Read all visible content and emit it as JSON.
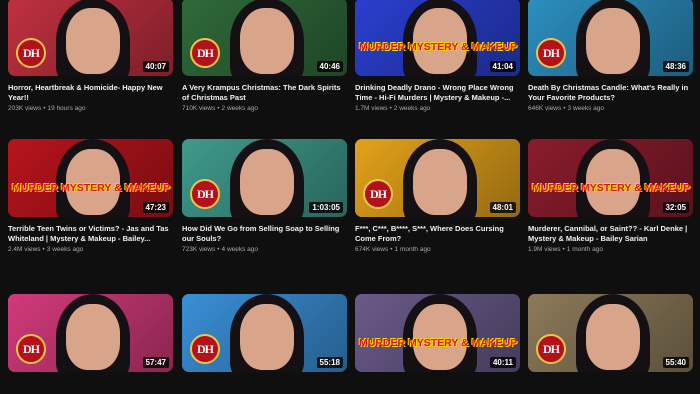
{
  "videos": [
    {
      "title": "Horror, Heartbreak & Homicide- Happy New Year!!",
      "views": "203K views",
      "age": "19 hours ago",
      "duration": "40:07",
      "bg": "#c03040",
      "badge": ""
    },
    {
      "title": "A Very Krampus Christmas: The Dark Spirits of Christmas Past",
      "views": "710K views",
      "age": "2 weeks ago",
      "duration": "40:46",
      "bg": "#2f6a3a",
      "badge": ""
    },
    {
      "title": "Drinking Deadly Drano - Wrong Place Wrong Time - Hi-Fi Murders | Mystery & Makeup -...",
      "views": "1.7M views",
      "age": "2 weeks ago",
      "duration": "41:04",
      "bg": "#2a3fd0",
      "badge": "MURDER MYSTERY & MAKEUP"
    },
    {
      "title": "Death By Christmas Candle: What's Really in Your Favorite Products?",
      "views": "646K views",
      "age": "3 weeks ago",
      "duration": "48:36",
      "bg": "#2c8fbf",
      "badge": ""
    },
    {
      "title": "Terrible Teen Twins or Victims? - Jas and Tas Whiteland | Mystery & Makeup - Bailey...",
      "views": "2.4M views",
      "age": "3 weeks ago",
      "duration": "47:23",
      "bg": "#b8141c",
      "badge": "MURDER MYSTERY & MAKEUP"
    },
    {
      "title": "How Did We Go from Selling Soap to Selling our Souls?",
      "views": "723K views",
      "age": "4 weeks ago",
      "duration": "1:03:05",
      "bg": "#3f9a8c",
      "badge": ""
    },
    {
      "title": "F***, C***, B****, S***, Where Does Cursing Come From?",
      "views": "674K views",
      "age": "1 month ago",
      "duration": "48:01",
      "bg": "#e3a21a",
      "badge": ""
    },
    {
      "title": "Murderer, Cannibal, or Saint?? - Karl Denke | Mystery & Makeup - Bailey Sarian",
      "views": "1.9M views",
      "age": "1 month ago",
      "duration": "32:05",
      "bg": "#8a1c2c",
      "badge": "MURDER MYSTERY & MAKEUP"
    },
    {
      "title": "",
      "views": "",
      "age": "",
      "duration": "57:47",
      "bg": "#d23a7a",
      "badge": ""
    },
    {
      "title": "",
      "views": "",
      "age": "",
      "duration": "55:18",
      "bg": "#3a8fd6",
      "badge": ""
    },
    {
      "title": "",
      "views": "",
      "age": "",
      "duration": "40:11",
      "bg": "#6a5a8a",
      "badge": "MURDER MYSTERY & MAKEUP"
    },
    {
      "title": "",
      "views": "",
      "age": "",
      "duration": "55:40",
      "bg": "#8c7a5a",
      "badge": ""
    }
  ],
  "channel_badge": "DH"
}
